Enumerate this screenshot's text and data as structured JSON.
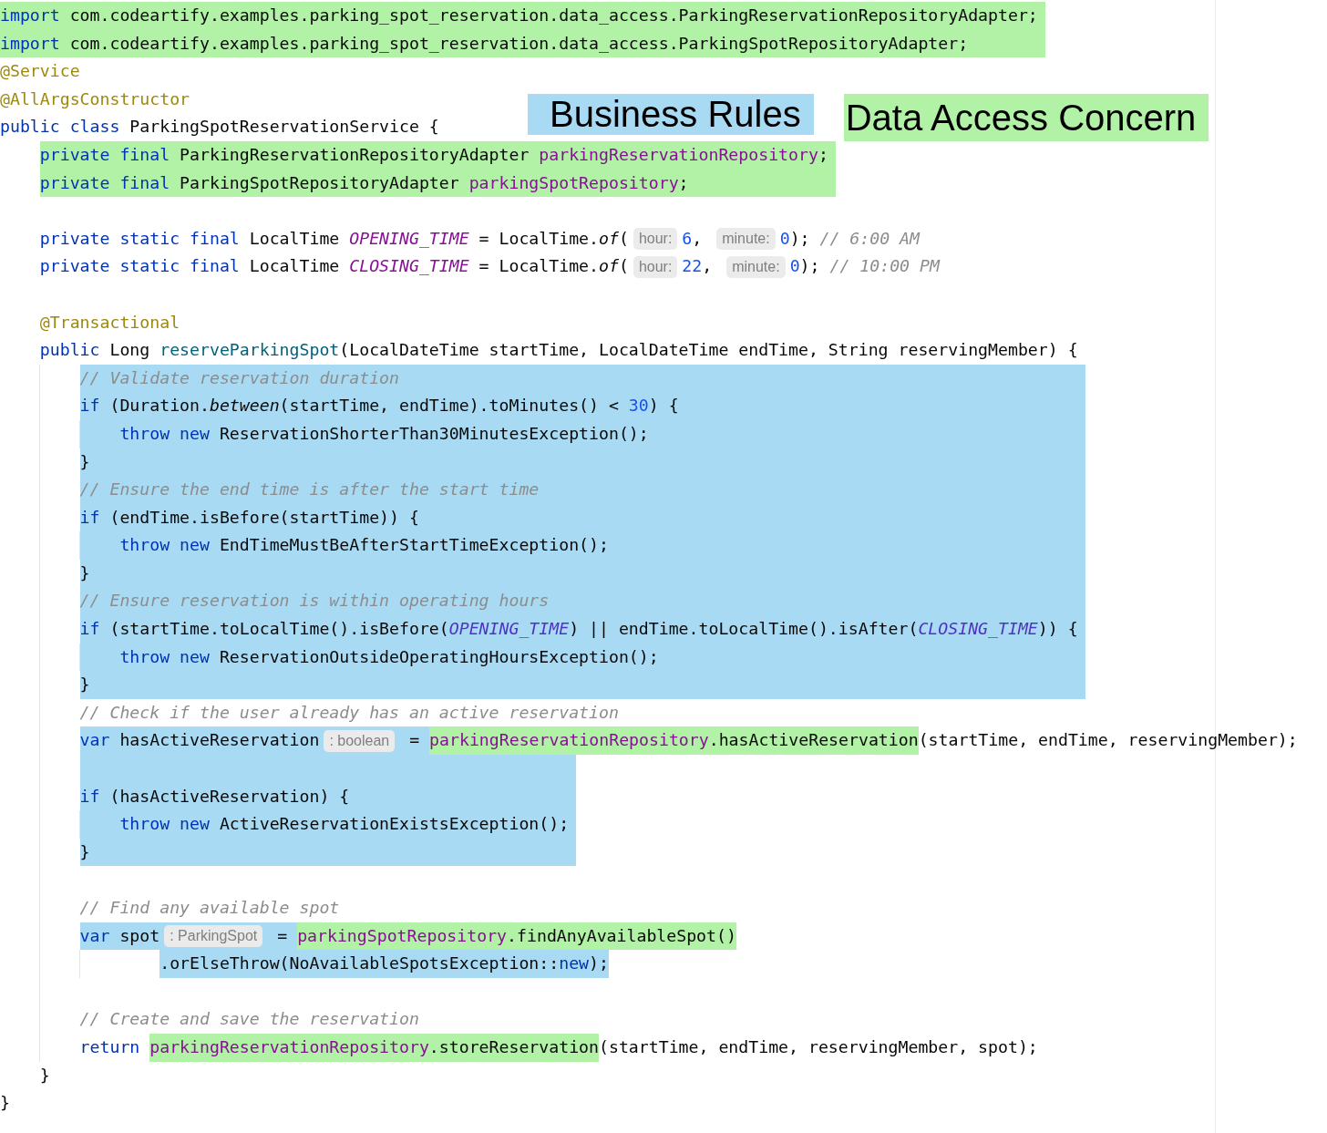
{
  "legend": [
    {
      "label": "Business Rules",
      "color": "#a8dbf3"
    },
    {
      "label": "Data Access Concern",
      "color": "#b1f2a6"
    }
  ],
  "code": [
    {
      "kind": "block",
      "color": "#b1f2a6",
      "lines": [
        {
          "kind": "line",
          "tokens": [
            {
              "text": "import",
              "kind": "kw"
            },
            {
              "text": " com.codeartify.examples.parking_spot_reservation.data_access.ParkingReservationRepositoryAdapter;",
              "kind": "plain"
            }
          ]
        },
        {
          "kind": "line",
          "tokens": [
            {
              "text": "import",
              "kind": "kw"
            },
            {
              "text": " com.codeartify.examples.parking_spot_reservation.data_access.ParkingSpotRepositoryAdapter;",
              "kind": "plain"
            }
          ]
        }
      ]
    },
    {
      "kind": "line",
      "tokens": [
        {
          "text": "@Service",
          "kind": "ann"
        }
      ]
    },
    {
      "kind": "line",
      "tokens": [
        {
          "text": "@AllArgsConstructor",
          "kind": "ann"
        }
      ]
    },
    {
      "kind": "line",
      "tokens": [
        {
          "text": "public class",
          "kind": "kw"
        },
        {
          "text": " ParkingSpotReservationService {",
          "kind": "plain"
        }
      ],
      "children": [
        {
          "kind": "block",
          "color": "#b1f2a6",
          "lines": [
            {
              "kind": "line",
              "tokens": [
                {
                  "text": "private final",
                  "kind": "kw"
                },
                {
                  "text": " ParkingReservationRepositoryAdapter ",
                  "kind": "plain"
                },
                {
                  "text": "parkingReservationRepository",
                  "kind": "field"
                },
                {
                  "text": ";",
                  "kind": "plain"
                }
              ]
            },
            {
              "kind": "line",
              "tokens": [
                {
                  "text": "private final",
                  "kind": "kw"
                },
                {
                  "text": " ParkingSpotRepositoryAdapter ",
                  "kind": "plain"
                },
                {
                  "text": "parkingSpotRepository",
                  "kind": "field"
                },
                {
                  "text": ";",
                  "kind": "plain"
                }
              ]
            }
          ]
        },
        {
          "kind": "blank"
        },
        {
          "kind": "line",
          "tokens": [
            {
              "text": "private static final",
              "kind": "kw"
            },
            {
              "text": " LocalTime ",
              "kind": "plain"
            },
            {
              "text": "OPENING_TIME",
              "kind": "const"
            },
            {
              "text": " = LocalTime.",
              "kind": "plain"
            },
            {
              "text": "of",
              "kind": "italic"
            },
            {
              "text": "(",
              "kind": "plain"
            },
            {
              "text": "hour:",
              "kind": "hint"
            },
            {
              "text": "6",
              "kind": "num"
            },
            {
              "text": ", ",
              "kind": "plain"
            },
            {
              "text": "minute:",
              "kind": "hint"
            },
            {
              "text": "0",
              "kind": "num"
            },
            {
              "text": "); ",
              "kind": "plain"
            },
            {
              "text": "// 6:00 AM",
              "kind": "comment"
            }
          ]
        },
        {
          "kind": "line",
          "tokens": [
            {
              "text": "private static final",
              "kind": "kw"
            },
            {
              "text": " LocalTime ",
              "kind": "plain"
            },
            {
              "text": "CLOSING_TIME",
              "kind": "const"
            },
            {
              "text": " = LocalTime.",
              "kind": "plain"
            },
            {
              "text": "of",
              "kind": "italic"
            },
            {
              "text": "(",
              "kind": "plain"
            },
            {
              "text": "hour:",
              "kind": "hint"
            },
            {
              "text": "22",
              "kind": "num"
            },
            {
              "text": ", ",
              "kind": "plain"
            },
            {
              "text": "minute:",
              "kind": "hint"
            },
            {
              "text": "0",
              "kind": "num"
            },
            {
              "text": "); ",
              "kind": "plain"
            },
            {
              "text": "// 10:00 PM",
              "kind": "comment"
            }
          ]
        },
        {
          "kind": "blank"
        },
        {
          "kind": "line",
          "tokens": [
            {
              "text": "@Transactional",
              "kind": "ann"
            }
          ]
        },
        {
          "kind": "line",
          "tokens": [
            {
              "text": "public",
              "kind": "kw"
            },
            {
              "text": " Long ",
              "kind": "plain"
            },
            {
              "text": "reserveParkingSpot",
              "kind": "decl"
            },
            {
              "text": "(LocalDateTime startTime, LocalDateTime endTime, String reservingMember) {",
              "kind": "plain"
            }
          ],
          "children": [
            {
              "kind": "block",
              "color": "#a8dbf3",
              "lines": [
                {
                  "kind": "line",
                  "tokens": [
                    {
                      "text": "// Validate reservation duration",
                      "kind": "comment"
                    }
                  ]
                },
                {
                  "kind": "line",
                  "tokens": [
                    {
                      "text": "if",
                      "kind": "kw"
                    },
                    {
                      "text": " (Duration.",
                      "kind": "plain"
                    },
                    {
                      "text": "between",
                      "kind": "italic"
                    },
                    {
                      "text": "(startTime, endTime).toMinutes() < ",
                      "kind": "plain"
                    },
                    {
                      "text": "30",
                      "kind": "num"
                    },
                    {
                      "text": ") {",
                      "kind": "plain"
                    }
                  ],
                  "children": [
                    {
                      "kind": "line",
                      "tokens": [
                        {
                          "text": "throw new",
                          "kind": "kw"
                        },
                        {
                          "text": " ReservationShorterThan30MinutesException();",
                          "kind": "plain"
                        }
                      ]
                    }
                  ]
                },
                {
                  "kind": "line",
                  "tokens": [
                    {
                      "text": "}",
                      "kind": "plain"
                    }
                  ]
                },
                {
                  "kind": "line",
                  "tokens": [
                    {
                      "text": "// Ensure the end time is after the start time",
                      "kind": "comment"
                    }
                  ]
                },
                {
                  "kind": "line",
                  "tokens": [
                    {
                      "text": "if",
                      "kind": "kw"
                    },
                    {
                      "text": " (endTime.isBefore(startTime)) {",
                      "kind": "plain"
                    }
                  ],
                  "children": [
                    {
                      "kind": "line",
                      "tokens": [
                        {
                          "text": "throw new",
                          "kind": "kw"
                        },
                        {
                          "text": " EndTimeMustBeAfterStartTimeException();",
                          "kind": "plain"
                        }
                      ]
                    }
                  ]
                },
                {
                  "kind": "line",
                  "tokens": [
                    {
                      "text": "}",
                      "kind": "plain"
                    }
                  ]
                },
                {
                  "kind": "line",
                  "tokens": [
                    {
                      "text": "// Ensure reservation is within operating hours",
                      "kind": "comment"
                    }
                  ]
                },
                {
                  "kind": "line",
                  "tokens": [
                    {
                      "text": "if",
                      "kind": "kw"
                    },
                    {
                      "text": " (startTime.toLocalTime().isBefore(",
                      "kind": "plain"
                    },
                    {
                      "text": "OPENING_TIME",
                      "kind": "constref"
                    },
                    {
                      "text": ") || endTime.toLocalTime().isAfter(",
                      "kind": "plain"
                    },
                    {
                      "text": "CLOSING_TIME",
                      "kind": "constref"
                    },
                    {
                      "text": ")) {",
                      "kind": "plain"
                    }
                  ],
                  "children": [
                    {
                      "kind": "line",
                      "tokens": [
                        {
                          "text": "throw new",
                          "kind": "kw"
                        },
                        {
                          "text": " ReservationOutsideOperatingHoursException();",
                          "kind": "plain"
                        }
                      ]
                    }
                  ]
                },
                {
                  "kind": "line",
                  "tokens": [
                    {
                      "text": "}",
                      "kind": "plain"
                    }
                  ]
                }
              ]
            },
            {
              "kind": "line",
              "tokens": [
                {
                  "text": "// Check if the user already has an active reservation",
                  "kind": "comment"
                }
              ]
            },
            {
              "kind": "line",
              "tokens": [
                {
                  "text": "var",
                  "kind": "kw",
                  "color": "#a8dbf3"
                },
                {
                  "text": " hasActiveReservation",
                  "kind": "plain",
                  "color": "#a8dbf3"
                },
                {
                  "text": ": boolean",
                  "kind": "hint"
                },
                {
                  "text": " = ",
                  "kind": "plain",
                  "color": "#a8dbf3"
                },
                {
                  "text": "parkingReservationRepository",
                  "kind": "field",
                  "color": "#b1f2a6"
                },
                {
                  "text": ".hasActiveReservation",
                  "kind": "plain",
                  "color": "#b1f2a6"
                },
                {
                  "text": "(startTime, endTime, reservingMember);",
                  "kind": "plain"
                }
              ]
            },
            {
              "kind": "block",
              "color": "#a8dbf3",
              "lines": [
                {
                  "kind": "blank"
                },
                {
                  "kind": "line",
                  "tokens": [
                    {
                      "text": "if",
                      "kind": "kw"
                    },
                    {
                      "text": " (hasActiveReservation) {",
                      "kind": "plain"
                    }
                  ],
                  "children": [
                    {
                      "kind": "line",
                      "tokens": [
                        {
                          "text": "throw new",
                          "kind": "kw"
                        },
                        {
                          "text": " ActiveReservationExistsException();",
                          "kind": "plain"
                        }
                      ]
                    }
                  ]
                },
                {
                  "kind": "line",
                  "tokens": [
                    {
                      "text": "}",
                      "kind": "plain"
                    }
                  ]
                }
              ]
            },
            {
              "kind": "blank"
            },
            {
              "kind": "line",
              "tokens": [
                {
                  "text": "// Find any available spot",
                  "kind": "comment"
                }
              ]
            },
            {
              "kind": "line",
              "tokens": [
                {
                  "text": "var",
                  "kind": "kw",
                  "color": "#a8dbf3"
                },
                {
                  "text": " spot",
                  "kind": "plain",
                  "color": "#a8dbf3"
                },
                {
                  "text": ": ParkingSpot",
                  "kind": "hint"
                },
                {
                  "text": " = ",
                  "kind": "plain",
                  "color": "#a8dbf3"
                },
                {
                  "text": "parkingSpotRepository",
                  "kind": "field",
                  "color": "#b1f2a6"
                },
                {
                  "text": ".findAnyAvailableSpot()",
                  "kind": "plain",
                  "color": "#b1f2a6"
                }
              ],
              "children": [
                {
                  "kind": "continuation",
                  "tokens": [
                    {
                      "text": ".orElseThrow(NoAvailableSpotsException::",
                      "kind": "plain",
                      "color": "#a8dbf3"
                    },
                    {
                      "text": "new",
                      "kind": "kw",
                      "color": "#a8dbf3"
                    },
                    {
                      "text": ");",
                      "kind": "plain",
                      "color": "#a8dbf3"
                    }
                  ]
                }
              ]
            },
            {
              "kind": "blank"
            },
            {
              "kind": "line",
              "tokens": [
                {
                  "text": "// Create and save the reservation",
                  "kind": "comment"
                }
              ]
            },
            {
              "kind": "line",
              "tokens": [
                {
                  "text": "return ",
                  "kind": "kw"
                },
                {
                  "text": "parkingReservationRepository",
                  "kind": "field",
                  "color": "#b1f2a6"
                },
                {
                  "text": ".storeReservation",
                  "kind": "plain",
                  "color": "#b1f2a6"
                },
                {
                  "text": "(startTime, endTime, reservingMember, spot);",
                  "kind": "plain"
                }
              ]
            }
          ]
        },
        {
          "kind": "line",
          "tokens": [
            {
              "text": "}",
              "kind": "plain"
            }
          ]
        }
      ]
    },
    {
      "kind": "line",
      "tokens": [
        {
          "text": "}",
          "kind": "plain"
        }
      ]
    }
  ]
}
